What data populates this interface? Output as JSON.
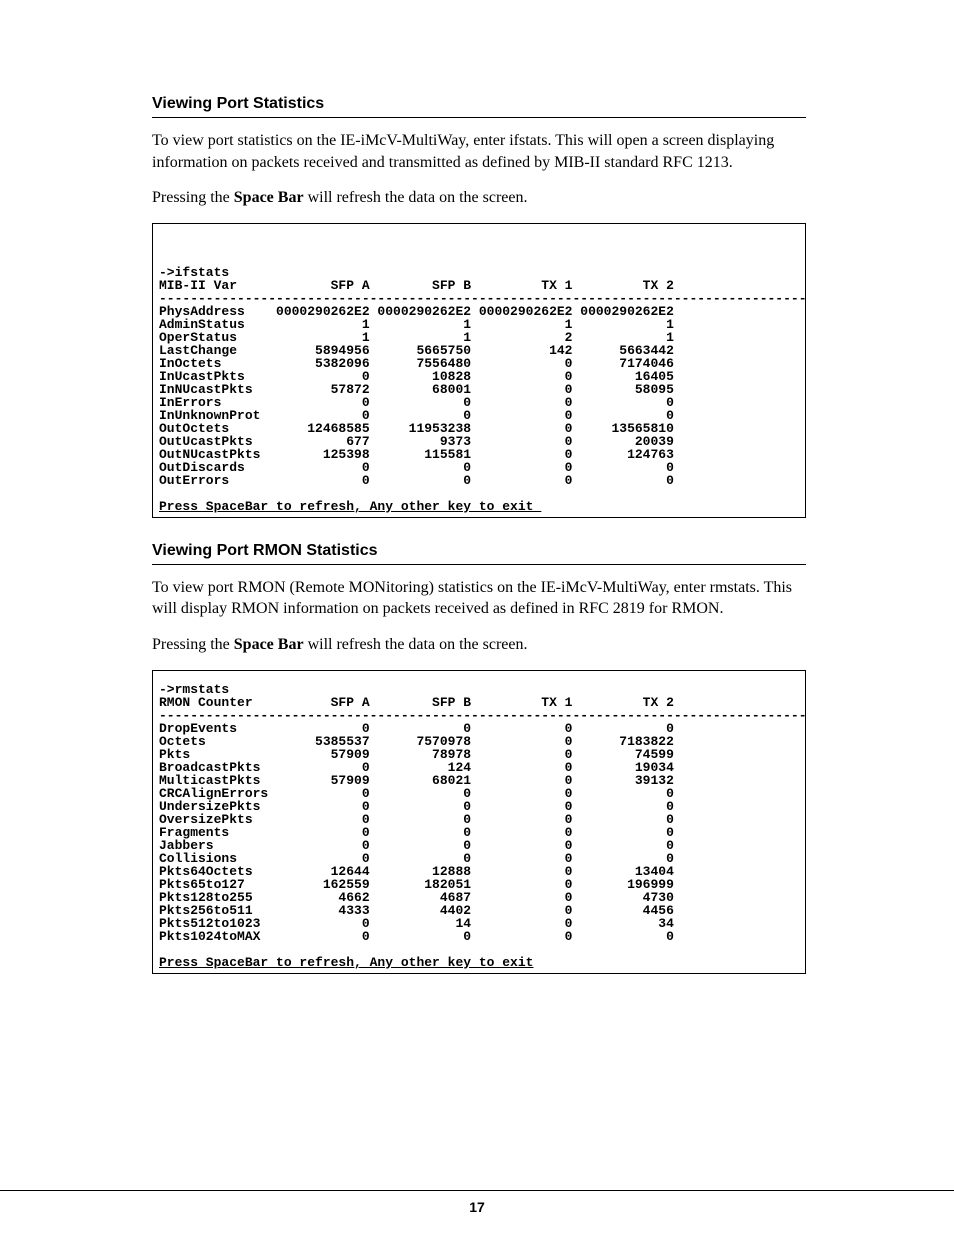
{
  "page_number": "17",
  "section1": {
    "title": "Viewing Port Statistics",
    "para1": "To view port statistics on the IE-iMcV-MultiWay, enter ifstats.  This will open a screen displaying information on packets received and transmitted as defined by MIB-II standard RFC 1213.",
    "para2_pre": "Pressing the ",
    "para2_bold": "Space Bar",
    "para2_post": " will refresh the data on the screen."
  },
  "section2": {
    "title": "Viewing Port RMON Statistics",
    "para1": "To view port RMON (Remote MONitoring) statistics on the IE-iMcV-MultiWay, enter rmstats.  This will display RMON information on packets received as defined in RFC 2819 for RMON.",
    "para2_pre": "Pressing the ",
    "para2_bold": "Space Bar",
    "para2_post": " will refresh the data on the screen."
  },
  "chart_data": [
    {
      "type": "table",
      "prompt": "->ifstats",
      "title_label": "MIB-II Var",
      "columns": [
        "SFP A",
        "SFP B",
        "TX 1",
        "TX 2"
      ],
      "rows": [
        {
          "name": "PhysAddress",
          "vals": [
            "0000290262E2",
            "0000290262E2",
            "0000290262E2",
            "0000290262E2"
          ]
        },
        {
          "name": "AdminStatus",
          "vals": [
            "1",
            "1",
            "1",
            "1"
          ]
        },
        {
          "name": "OperStatus",
          "vals": [
            "1",
            "1",
            "2",
            "1"
          ]
        },
        {
          "name": "LastChange",
          "vals": [
            "5894956",
            "5665750",
            "142",
            "5663442"
          ]
        },
        {
          "name": "InOctets",
          "vals": [
            "5382096",
            "7556480",
            "0",
            "7174046"
          ]
        },
        {
          "name": "InUcastPkts",
          "vals": [
            "0",
            "10828",
            "0",
            "16405"
          ]
        },
        {
          "name": "InNUcastPkts",
          "vals": [
            "57872",
            "68001",
            "0",
            "58095"
          ]
        },
        {
          "name": "InErrors",
          "vals": [
            "0",
            "0",
            "0",
            "0"
          ]
        },
        {
          "name": "InUnknownProt",
          "vals": [
            "0",
            "0",
            "0",
            "0"
          ]
        },
        {
          "name": "OutOctets",
          "vals": [
            "12468585",
            "11953238",
            "0",
            "13565810"
          ]
        },
        {
          "name": "OutUcastPkts",
          "vals": [
            "677",
            "9373",
            "0",
            "20039"
          ]
        },
        {
          "name": "OutNUcastPkts",
          "vals": [
            "125398",
            "115581",
            "0",
            "124763"
          ]
        },
        {
          "name": "OutDiscards",
          "vals": [
            "0",
            "0",
            "0",
            "0"
          ]
        },
        {
          "name": "OutErrors",
          "vals": [
            "0",
            "0",
            "0",
            "0"
          ]
        }
      ],
      "footer": "Press SpaceBar to refresh, Any other key to exit_"
    },
    {
      "type": "table",
      "prompt": "->rmstats",
      "title_label": "RMON Counter",
      "columns": [
        "SFP A",
        "SFP B",
        "TX 1",
        "TX 2"
      ],
      "rows": [
        {
          "name": "DropEvents",
          "vals": [
            "0",
            "0",
            "0",
            "0"
          ]
        },
        {
          "name": "Octets",
          "vals": [
            "5385537",
            "7570978",
            "0",
            "7183822"
          ]
        },
        {
          "name": "Pkts",
          "vals": [
            "57909",
            "78978",
            "0",
            "74599"
          ]
        },
        {
          "name": "BroadcastPkts",
          "vals": [
            "0",
            "124",
            "0",
            "19034"
          ]
        },
        {
          "name": "MulticastPkts",
          "vals": [
            "57909",
            "68021",
            "0",
            "39132"
          ]
        },
        {
          "name": "CRCAlignErrors",
          "vals": [
            "0",
            "0",
            "0",
            "0"
          ]
        },
        {
          "name": "UndersizePkts",
          "vals": [
            "0",
            "0",
            "0",
            "0"
          ]
        },
        {
          "name": "OversizePkts",
          "vals": [
            "0",
            "0",
            "0",
            "0"
          ]
        },
        {
          "name": "Fragments",
          "vals": [
            "0",
            "0",
            "0",
            "0"
          ]
        },
        {
          "name": "Jabbers",
          "vals": [
            "0",
            "0",
            "0",
            "0"
          ]
        },
        {
          "name": "Collisions",
          "vals": [
            "0",
            "0",
            "0",
            "0"
          ]
        },
        {
          "name": "Pkts64Octets",
          "vals": [
            "12644",
            "12888",
            "0",
            "13404"
          ]
        },
        {
          "name": "Pkts65to127",
          "vals": [
            "162559",
            "182051",
            "0",
            "196999"
          ]
        },
        {
          "name": "Pkts128to255",
          "vals": [
            "4662",
            "4687",
            "0",
            "4730"
          ]
        },
        {
          "name": "Pkts256to511",
          "vals": [
            "4333",
            "4402",
            "0",
            "4456"
          ]
        },
        {
          "name": "Pkts512to1023",
          "vals": [
            "0",
            "14",
            "0",
            "34"
          ]
        },
        {
          "name": "Pkts1024toMAX",
          "vals": [
            "0",
            "0",
            "0",
            "0"
          ]
        }
      ],
      "footer": "Press SpaceBar to refresh, Any other key to exit"
    }
  ]
}
